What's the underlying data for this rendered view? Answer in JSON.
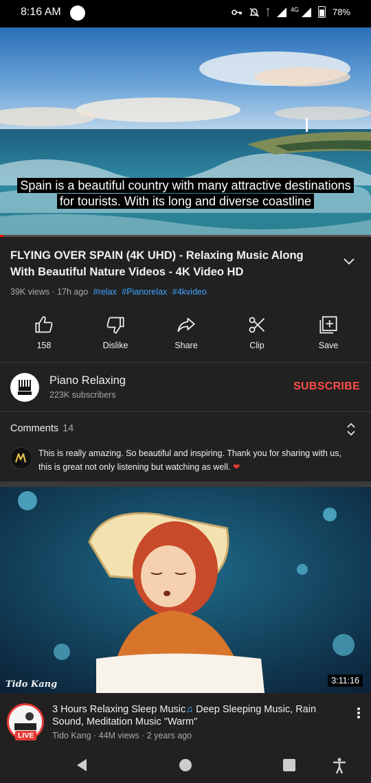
{
  "status_bar": {
    "time": "8:16 AM",
    "network": "4G",
    "battery": "78%"
  },
  "player": {
    "caption_line1": "Spain is a beautiful country with many attractive destinations",
    "caption_line2": "for tourists. With its long and diverse coastline",
    "progress": 0.01
  },
  "video": {
    "title": "FLYING OVER SPAIN (4K UHD) - Relaxing Music Along With Beautiful Nature Videos - 4K Video HD",
    "views_age": "39K views · 17h ago",
    "tags": [
      "#relax",
      "#Pianorelax",
      "#4kvideo"
    ]
  },
  "actions": {
    "like": "158",
    "dislike": "Dislike",
    "share": "Share",
    "clip": "Clip",
    "save": "Save"
  },
  "channel": {
    "name": "Piano Relaxing",
    "subscribers": "223K subscribers",
    "subscribe_label": "SUBSCRIBE"
  },
  "comments": {
    "heading": "Comments",
    "count": "14",
    "top_comment": "This is really amazing. So beautiful and inspiring. Thank you for sharing with us, this is great not only listening but watching as well."
  },
  "next_video": {
    "watermark": "Tido Kang",
    "duration": "3:11:16",
    "title_part1": "3 Hours Relaxing Sleep Music",
    "title_part2": " Deep Sleeping Music, Rain Sound, Meditation Music \"Warm\"",
    "live_badge": "LIVE",
    "meta": "Tido Kang · 44M views · 2 years ago"
  },
  "icons": {
    "back": "back-triangle-icon",
    "home": "home-circle-icon",
    "recents": "recents-square-icon",
    "accessibility": "accessibility-icon"
  },
  "colors": {
    "background": "#212121",
    "accent_red": "#ff4e45",
    "link_blue": "#3ea6ff"
  }
}
